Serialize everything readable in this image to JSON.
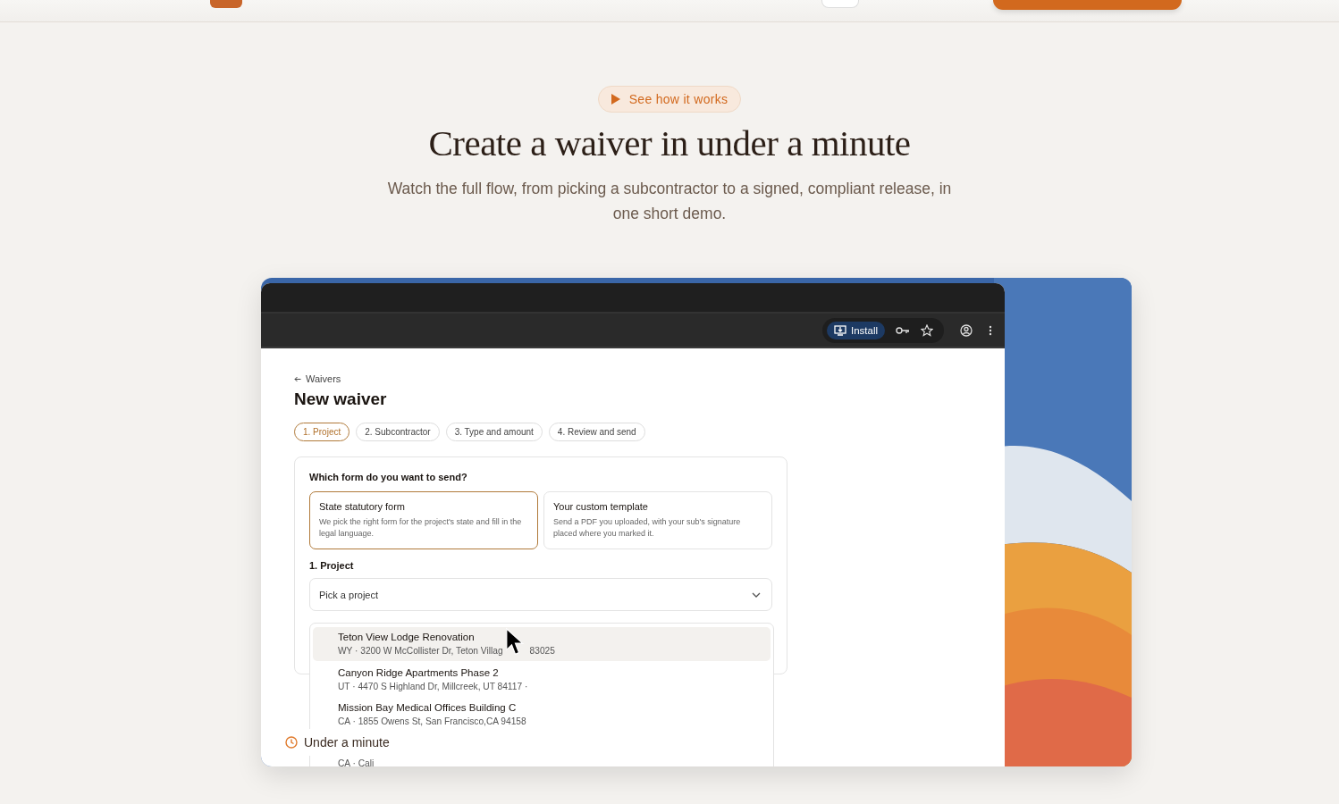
{
  "hero": {
    "pill": "See how it works",
    "title": "Create a waiver in under a minute",
    "subtitle": "Watch the full flow, from picking a subcontractor to a signed, compliant release, in one short demo."
  },
  "demo": {
    "browser": {
      "install": "Install"
    },
    "back": "Waivers",
    "title": "New waiver",
    "steps": [
      {
        "label": "1. Project",
        "selected": true
      },
      {
        "label": "2. Subcontractor",
        "selected": false
      },
      {
        "label": "3. Type and amount",
        "selected": false
      },
      {
        "label": "4. Review and send",
        "selected": false
      }
    ],
    "question": "Which form do you want to send?",
    "options": [
      {
        "title": "State statutory form",
        "text": "We pick the right form for the project's state and fill in the legal language.",
        "selected": true
      },
      {
        "title": "Your custom template",
        "text": "Send a PDF you uploaded, with your sub's signature placed where you marked it.",
        "selected": false
      }
    ],
    "project_label": "1. Project",
    "select": {
      "placeholder": "Pick a project"
    },
    "projects": [
      {
        "name": "Teton View Lodge Renovation",
        "address": "WY · 3200 W McCollister Dr, Teton Villag",
        "address_tail": "83025",
        "selected": true
      },
      {
        "name": "Canyon Ridge Apartments Phase 2",
        "address": "UT · 4470 S Highland Dr, Millcreek, UT 84117 ·",
        "selected": false
      },
      {
        "name": "Mission Bay Medical Offices Building C",
        "address": "CA · 1855 Owens St, San Francisco,CA 94158",
        "selected": false
      },
      {
        "address": "CA · Cali",
        "selected": false
      }
    ],
    "badge": "Under a minute"
  }
}
